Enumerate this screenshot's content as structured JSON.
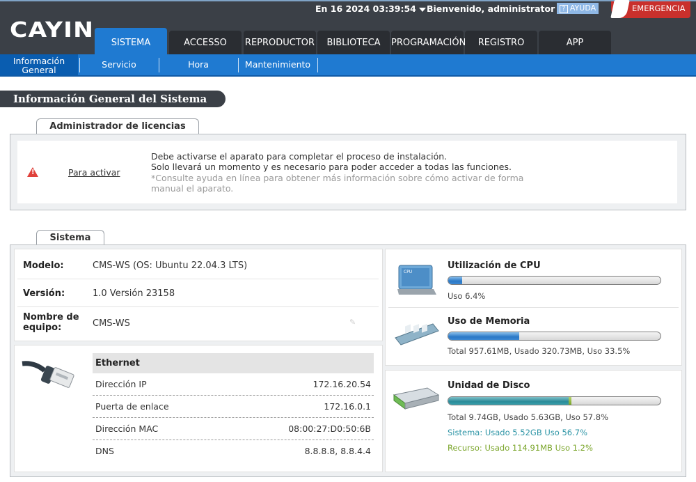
{
  "header": {
    "logo": "CAYIN",
    "datetime": "En 16 2024 03:39:54",
    "welcome": "Bienvenido, administrator",
    "help": "AYUDA",
    "emergency": "EMERGENCIA"
  },
  "tabs": [
    "SISTEMA",
    "ACCESSO",
    "REPRODUCTOR",
    "BIBLIOTECA",
    "PROGRAMACIÓN",
    "REGISTRO",
    "APP"
  ],
  "subnav": {
    "active_line1": "Información",
    "active_line2": "General",
    "items": [
      "Servicio",
      "Hora",
      "Mantenimiento"
    ]
  },
  "page_title": "Información General del Sistema",
  "license": {
    "tab": "Administrador de licencias",
    "link": "Para activar",
    "line1": "Debe activarse el aparato para completar el proceso de instalación.",
    "line2": "Solo llevará un momento y es necesario para poder acceder a todas las funciones.",
    "note": "*Consulte ayuda en línea para obtener más información sobre cómo activar de forma manual el aparato."
  },
  "system": {
    "tab": "Sistema",
    "model_label": "Modelo:",
    "model_value": "CMS-WS (OS: Ubuntu 22.04.3 LTS)",
    "version_label": "Versión:",
    "version_value": "1.0 Versión 23158",
    "hostname_label_1": "Nombre de",
    "hostname_label_2": "equipo:",
    "hostname_value": "CMS-WS"
  },
  "ethernet": {
    "title": "Ethernet",
    "rows": [
      {
        "label": "Dirección IP",
        "value": "172.16.20.54"
      },
      {
        "label": "Puerta de enlace",
        "value": "172.16.0.1"
      },
      {
        "label": "Dirección MAC",
        "value": "08:00:27:D0:50:6B"
      },
      {
        "label": "DNS",
        "value": "8.8.8.8, 8.8.4.4"
      }
    ]
  },
  "resources": {
    "cpu": {
      "title": "Utilización de CPU",
      "usage_text": "Uso 6.4%",
      "percent": 6.4
    },
    "memory": {
      "title": "Uso de Memoria",
      "usage_text": "Total 957.61MB, Usado 320.73MB, Uso 33.5%",
      "percent": 33.5
    },
    "disk": {
      "title": "Unidad de Disco",
      "usage_text": "Total 9.74GB, Usado 5.63GB, Uso 57.8%",
      "system_text": "Sistema: Usado 5.52GB Uso 56.7%",
      "resource_text": "Recurso: Usado 114.91MB Uso 1.2%",
      "system_percent": 56.7,
      "resource_percent": 1.2
    }
  }
}
